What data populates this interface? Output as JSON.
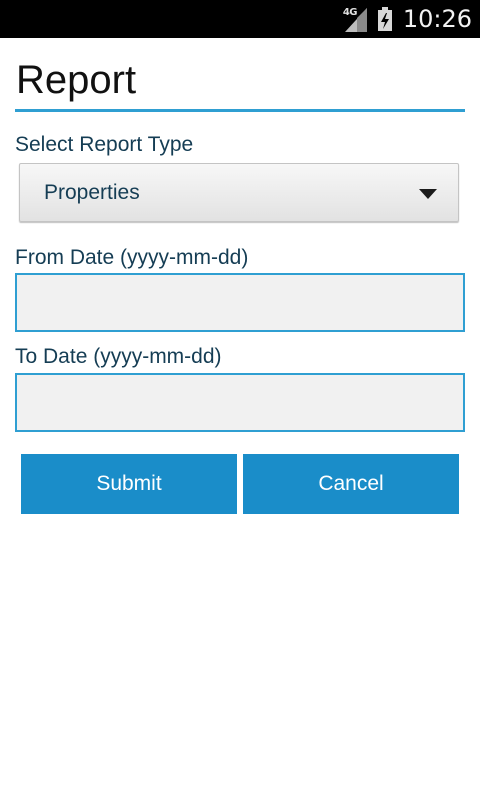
{
  "status_bar": {
    "network_type": "4G",
    "time": "10:26",
    "icons": [
      "signal-icon",
      "battery-charging-icon"
    ]
  },
  "screen": {
    "title": "Report"
  },
  "report_type": {
    "label": "Select Report Type",
    "selected": "Properties"
  },
  "from_date": {
    "label": "From Date (yyyy-mm-dd)",
    "value": ""
  },
  "to_date": {
    "label": "To  Date (yyyy-mm-dd)",
    "value": ""
  },
  "actions": {
    "submit_label": "Submit",
    "cancel_label": "Cancel"
  },
  "colors": {
    "accent": "#2f9fd2",
    "button": "#1a8dc9",
    "label_text": "#153d54",
    "status_bar": "#000000"
  }
}
